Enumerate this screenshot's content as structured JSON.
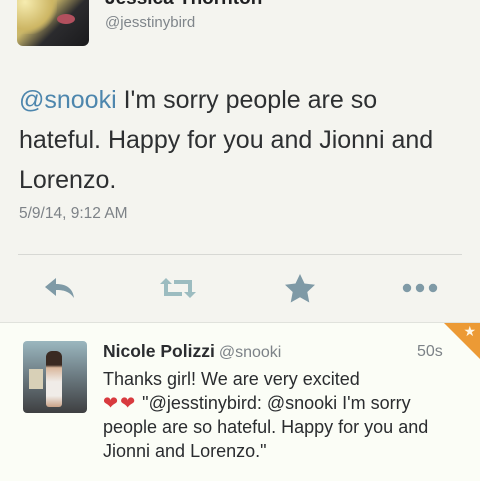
{
  "tweet": {
    "author_name": "Jessica Thornton",
    "author_handle": "@jesstinybird",
    "mention": "@snooki",
    "text": " I'm sorry people are so hateful. Happy for you and Jionni and Lorenzo.",
    "timestamp": "5/9/14, 9:12 AM"
  },
  "actions": {
    "reply_icon": "reply-icon",
    "retweet_icon": "retweet-icon",
    "favorite_icon": "star-icon",
    "more_icon": "more-icon"
  },
  "reply": {
    "name": "Nicole Polizzi",
    "handle": "@snooki",
    "time": "50s",
    "text_line1": "Thanks girl! We are very excited",
    "hearts": "❤❤",
    "quote": " \"@jesstinybird: @snooki I'm sorry people are so hateful. Happy for you and Jionni and Lorenzo.\""
  },
  "colors": {
    "mention": "#4d86ad",
    "action_icon": "#7f9aa6",
    "retweet_icon": "#9cbcc0",
    "badge": "#ec9a35",
    "heart": "#d83a3e"
  }
}
